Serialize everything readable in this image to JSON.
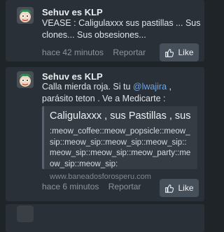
{
  "posts": [
    {
      "username": "Sehuv es KLP",
      "text": "VEASE : Caligulaxxx sus pastillas ... Sus clones... Sus obsesiones...",
      "time": "hace 42 minutos",
      "report_label": "Reportar",
      "like_label": "Like"
    },
    {
      "username": "Sehuv es KLP",
      "text_before": "Calla mierda roja. Si tu ",
      "mention": "@lwajira",
      "text_after": " , parásito teton . Ve a Medicarte :",
      "embed": {
        "title": "Caligulaxxx , sus Pastillas , sus clones ,...",
        "description": ":meow_coffee::meow_popsicle::meow_sip::meow_sip::meow_sip::meow_sip::meow_sip::meow_sip::meow_party::meow_sip::meow_sip:",
        "domain": "www.baneadosforosperu.com"
      },
      "time": "hace 6 minutos",
      "report_label": "Reportar",
      "like_label": "Like"
    }
  ],
  "icons": {
    "like": "thumbs-up-icon",
    "avatar": "cartoon-face-avatar"
  },
  "colors": {
    "background": "#1f2429",
    "card": "#2a3037",
    "mention": "#6ea6e8",
    "like_button": "#46505b"
  }
}
